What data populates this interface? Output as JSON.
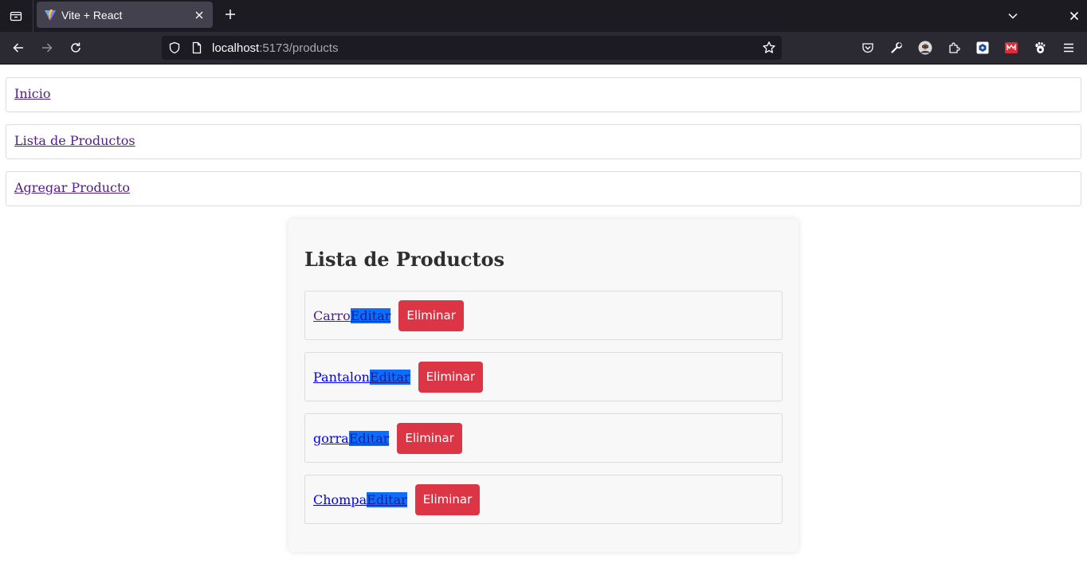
{
  "browser": {
    "tab_title": "Vite + React",
    "url_host": "localhost",
    "url_rest": ":5173/products"
  },
  "nav_links": [
    "Inicio",
    "Lista de Productos",
    "Agregar Producto"
  ],
  "product_list": {
    "title": "Lista de Productos",
    "edit_label": "Editar",
    "delete_label": "Eliminar",
    "items": [
      {
        "name": "Carro",
        "visited": true
      },
      {
        "name": "Pantalon",
        "visited": false
      },
      {
        "name": "gorra",
        "visited": false
      },
      {
        "name": "Chompa",
        "visited": false
      }
    ]
  },
  "colors": {
    "chrome_dark": "#1c1b22",
    "toolbar": "#2b2a33",
    "link_visited": "#551a8b",
    "link": "#0000ee",
    "edit_bg": "#0d6efd",
    "delete_bg": "#dc3545"
  },
  "icons": {
    "tab_list": "tab-list-icon",
    "back": "back-arrow-icon",
    "forward": "forward-arrow-icon",
    "reload": "reload-icon",
    "shield": "shield-icon",
    "page": "page-icon",
    "bookmark": "star-icon",
    "pocket": "pocket-icon",
    "tools": "wrench-icon",
    "profile": "avatar",
    "extensions": "puzzle-icon",
    "menu": "hamburger-menu-icon"
  }
}
